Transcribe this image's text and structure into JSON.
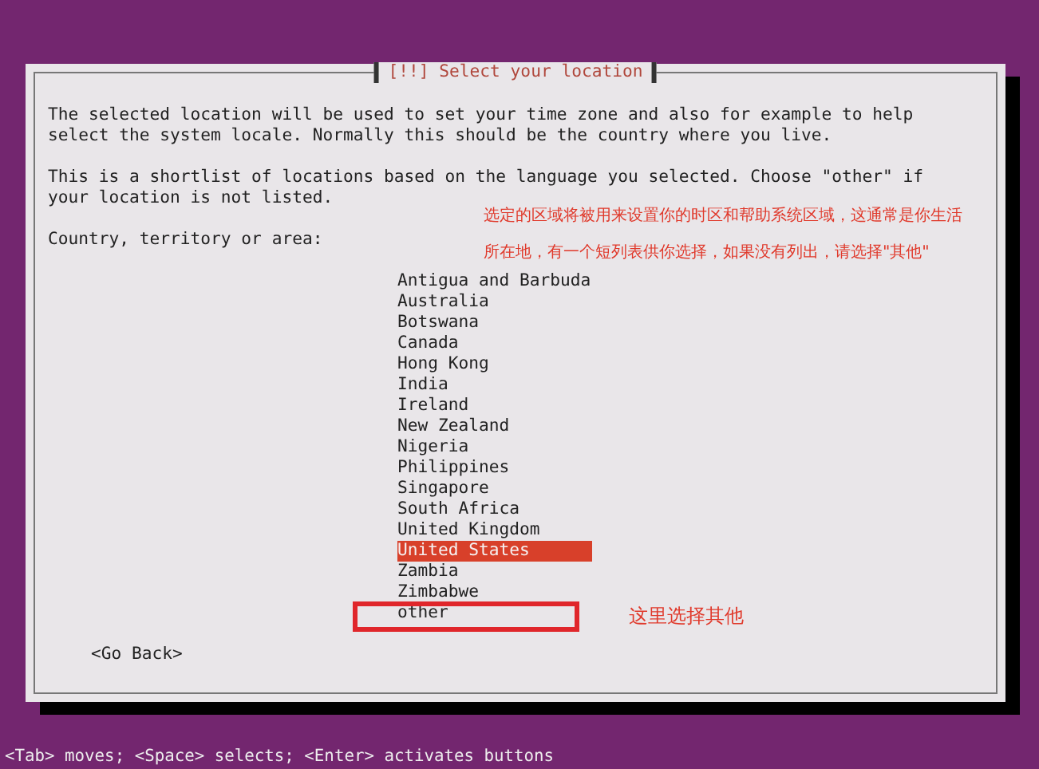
{
  "window": {
    "title": "[!!] Select your location"
  },
  "paragraphs": [
    "The selected location will be used to set your time zone and also for example to help select the system locale. Normally this should be the country where you live.",
    "This is a shortlist of locations based on the language you selected. Choose \"other\" if your location is not listed."
  ],
  "field_label": "Country, territory or area:",
  "countries": [
    {
      "label": "Antigua and Barbuda",
      "selected": false
    },
    {
      "label": "Australia",
      "selected": false
    },
    {
      "label": "Botswana",
      "selected": false
    },
    {
      "label": "Canada",
      "selected": false
    },
    {
      "label": "Hong Kong",
      "selected": false
    },
    {
      "label": "India",
      "selected": false
    },
    {
      "label": "Ireland",
      "selected": false
    },
    {
      "label": "New Zealand",
      "selected": false
    },
    {
      "label": "Nigeria",
      "selected": false
    },
    {
      "label": "Philippines",
      "selected": false
    },
    {
      "label": "Singapore",
      "selected": false
    },
    {
      "label": "South Africa",
      "selected": false
    },
    {
      "label": "United Kingdom",
      "selected": false
    },
    {
      "label": "United States",
      "selected": true
    },
    {
      "label": "Zambia",
      "selected": false
    },
    {
      "label": "Zimbabwe",
      "selected": false
    },
    {
      "label": "other",
      "selected": false
    }
  ],
  "annotations": [
    {
      "text": "选定的区域将被用来设置你的时区和帮助系统区域，这通常是你生活所在地，有一个短列表供你选择，如果没有列出，请选择\"其他\""
    },
    {
      "text": "这里选择其他"
    }
  ],
  "go_back_button": "<Go Back>",
  "status_bar": "<Tab> moves; <Space> selects; <Enter> activates buttons"
}
